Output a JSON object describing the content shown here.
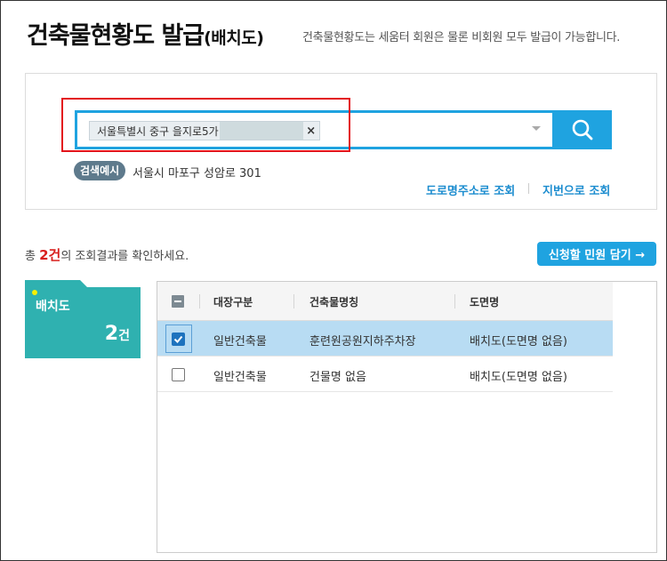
{
  "header": {
    "title": "건축물현황도 발급",
    "title_sub": "(배치도)",
    "description": "건축물현황도는 세움터 회원은 물론 비회원 모두 발급이 가능합니다."
  },
  "search": {
    "chip_text": "서울특별시 중구 을지로5가",
    "chip_remove": "×",
    "search_icon": "search-icon",
    "example_badge": "검색예시",
    "example_text": "서울시 마포구 성암로 301",
    "link_road": "도로명주소로 조회",
    "link_lot": "지번으로 조회"
  },
  "results": {
    "summary_prefix": "총 ",
    "summary_count": "2건",
    "summary_suffix": "의 조회결과를 확인하세요.",
    "cart_button": "신청할 민원 담기 →"
  },
  "type_card": {
    "label": "배치도",
    "count": "2",
    "count_unit": "건"
  },
  "table": {
    "columns": [
      "대장구분",
      "건축물명칭",
      "도면명"
    ],
    "rows": [
      {
        "checked": true,
        "register_type": "일반건축물",
        "building_name": "훈련원공원지하주차장",
        "drawing_name": "배치도(도면명 없음)"
      },
      {
        "checked": false,
        "register_type": "일반건축물",
        "building_name": "건물명 없음",
        "drawing_name": "배치도(도면명 없음)"
      }
    ]
  },
  "colors": {
    "accent": "#1fa3e0",
    "highlight": "#e3141b",
    "card": "#2fb1b0",
    "selected_row": "#b8dcf3"
  }
}
